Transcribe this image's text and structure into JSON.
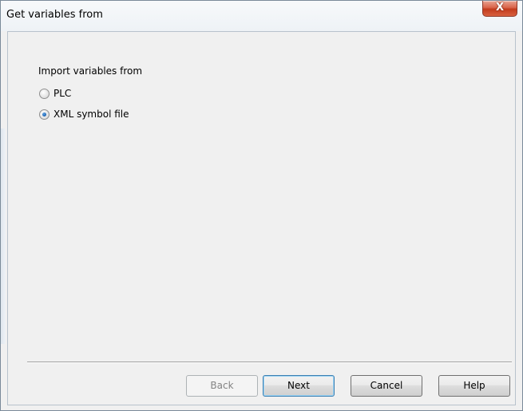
{
  "window": {
    "title": "Get variables from",
    "close_glyph": "X"
  },
  "content": {
    "section_label": "Import variables from",
    "options": [
      {
        "label": "PLC",
        "selected": false
      },
      {
        "label": "XML symbol file",
        "selected": true
      }
    ]
  },
  "buttons": {
    "back": "Back",
    "next": "Next",
    "cancel": "Cancel",
    "help": "Help"
  }
}
